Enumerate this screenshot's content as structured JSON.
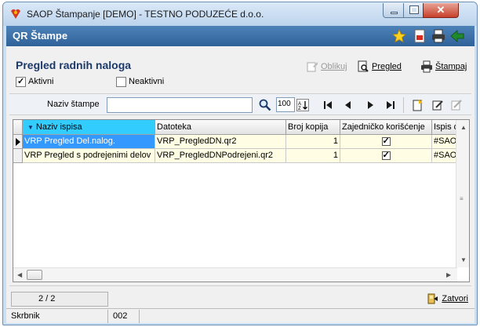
{
  "window": {
    "title": "SAOP Štampanje [DEMO] - TESTNO PODUZEĆE d.o.o."
  },
  "form": {
    "title": "QR Štampe",
    "header_icons": [
      "star-icon",
      "pdf-icon",
      "printer-icon",
      "exit-icon"
    ]
  },
  "page": {
    "subtitle": "Pregled radnih naloga",
    "filters": [
      {
        "label": "Aktivni",
        "checked": true
      },
      {
        "label": "Neaktivni",
        "checked": false
      }
    ],
    "actions": {
      "oblikuj": "Oblikuj",
      "pregled": "Pregled",
      "stampaj": "Štampaj"
    }
  },
  "search": {
    "label": "Naziv štampe",
    "value": "",
    "row_count": "100"
  },
  "grid": {
    "columns": [
      "Naziv ispisa",
      "Datoteka",
      "Broj kopija",
      "Zajedničko korišćenje",
      "Ispis d"
    ],
    "rows": [
      {
        "naziv": "VRP Pregled Del.nalog.",
        "datoteka": "VRP_PregledDN.qr2",
        "kopije": "1",
        "zajednicko": true,
        "ispis": "#SAOP"
      },
      {
        "naziv": "VRP Pregled s podrejenimi delov",
        "datoteka": "VRP_PregledDNPodrejeni.qr2",
        "kopije": "1",
        "zajednicko": true,
        "ispis": "#SAOP"
      }
    ]
  },
  "footer": {
    "pager": "2 / 2",
    "close_label": "Zatvori"
  },
  "statusbar": {
    "user_label": "Skrbnik",
    "code": "002"
  },
  "colors": {
    "form_header": "#2f6299",
    "active_column": "#33ccff",
    "selected_cell": "#3399ff",
    "row_background": "#fffde3"
  }
}
